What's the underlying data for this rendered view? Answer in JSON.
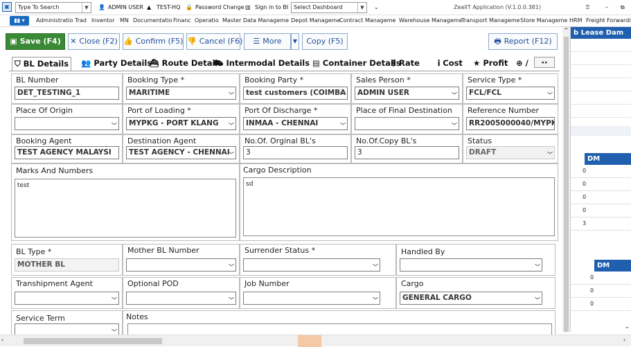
{
  "topbar": {
    "search_placeholder": "Type To Search",
    "user": "ADMIN USER",
    "branch": "TEST-HQ",
    "password_change": "Password Change",
    "sign_in_bi": "Sign in to BI",
    "dashboard_select": "Select Dashboard",
    "app_title": "ZealIT Application (V.1.0.0.381)"
  },
  "menu": {
    "items": [
      "Administratio",
      "Trad",
      "Inventor",
      "MN",
      "Documentatio",
      "Financ",
      "Operatio",
      "Master Data Manageme",
      "Depot Manageme",
      "Contract Manageme",
      "Warehouse Manageme",
      "Transport Manageme",
      "Store Manageme",
      "HRM",
      "Freight Forwardin"
    ]
  },
  "toolbar": {
    "save": "Save (F4)",
    "close": "Close (F2)",
    "confirm": "Confirm (F5)",
    "cancel": "Cancel (F6)",
    "more": "More",
    "copy": "Copy (F5)",
    "report": "Report (F12)"
  },
  "tabs": [
    "BL Details",
    "Party Details",
    "Route Details",
    "Intermodal Details",
    "Container Details",
    "Rate",
    "Cost",
    "Profit"
  ],
  "form": {
    "bl_number": {
      "label": "BL Number",
      "value": "DET_TESTING_1"
    },
    "booking_type": {
      "label": "Booking Type *",
      "value": "MARITIME"
    },
    "booking_party": {
      "label": "Booking Party *",
      "value": "test customers (COIMBA"
    },
    "sales_person": {
      "label": "Sales Person *",
      "value": "ADMIN USER"
    },
    "service_type": {
      "label": "Service Type *",
      "value": "FCL/FCL"
    },
    "place_of_origin": {
      "label": "Place Of Origin",
      "value": ""
    },
    "port_of_loading": {
      "label": "Port of Loading *",
      "value": "MYPKG - PORT KLANG"
    },
    "port_of_discharge": {
      "label": "Port Of Discharge *",
      "value": "INMAA - CHENNAI"
    },
    "place_final_dest": {
      "label": "Place of Final Destination",
      "value": ""
    },
    "reference_number": {
      "label": "Reference Number",
      "value": "RR2005000040/MYPK"
    },
    "booking_agent": {
      "label": "Booking Agent",
      "value": "TEST AGENCY MALAYSI"
    },
    "destination_agent": {
      "label": "Destination Agent",
      "value": "TEST AGENCY - CHENNAI"
    },
    "orig_bls": {
      "label": "No.Of. Orginal BL's",
      "value": "3"
    },
    "copy_bls": {
      "label": "No.Of.Copy BL's",
      "value": "3"
    },
    "status": {
      "label": "Status",
      "value": "DRAFT"
    },
    "marks": {
      "label": "Marks And Numbers",
      "value": "test"
    },
    "cargo_desc": {
      "label": "Cargo Description",
      "value": "sd"
    },
    "bl_type": {
      "label": "BL Type *",
      "value": "MOTHER BL"
    },
    "mother_bl": {
      "label": "Mother BL Number",
      "value": ""
    },
    "surrender": {
      "label": "Surrender Status *",
      "value": ""
    },
    "handled_by": {
      "label": "Handled By",
      "value": ""
    },
    "tranship_agent": {
      "label": "Transhipment Agent",
      "value": ""
    },
    "optional_pod": {
      "label": "Optional POD",
      "value": ""
    },
    "job_number": {
      "label": "Job Number",
      "value": ""
    },
    "cargo": {
      "label": "Cargo",
      "value": "GENERAL CARGO"
    },
    "service_term": {
      "label": "Service Term",
      "value": ""
    },
    "notes": {
      "label": "Notes",
      "value": ""
    }
  },
  "right_panel": {
    "header": "b Lease Dam",
    "grid1_header": "DM",
    "grid1_values": [
      "0",
      "0",
      "0",
      "0",
      "3"
    ],
    "grid2_header": "DM",
    "grid2_values": [
      "0",
      "0",
      "0"
    ]
  },
  "colors": {
    "save_green": "#3a8a35",
    "accent_blue": "#1a6bbf",
    "panel_header": "#1f5fae"
  }
}
